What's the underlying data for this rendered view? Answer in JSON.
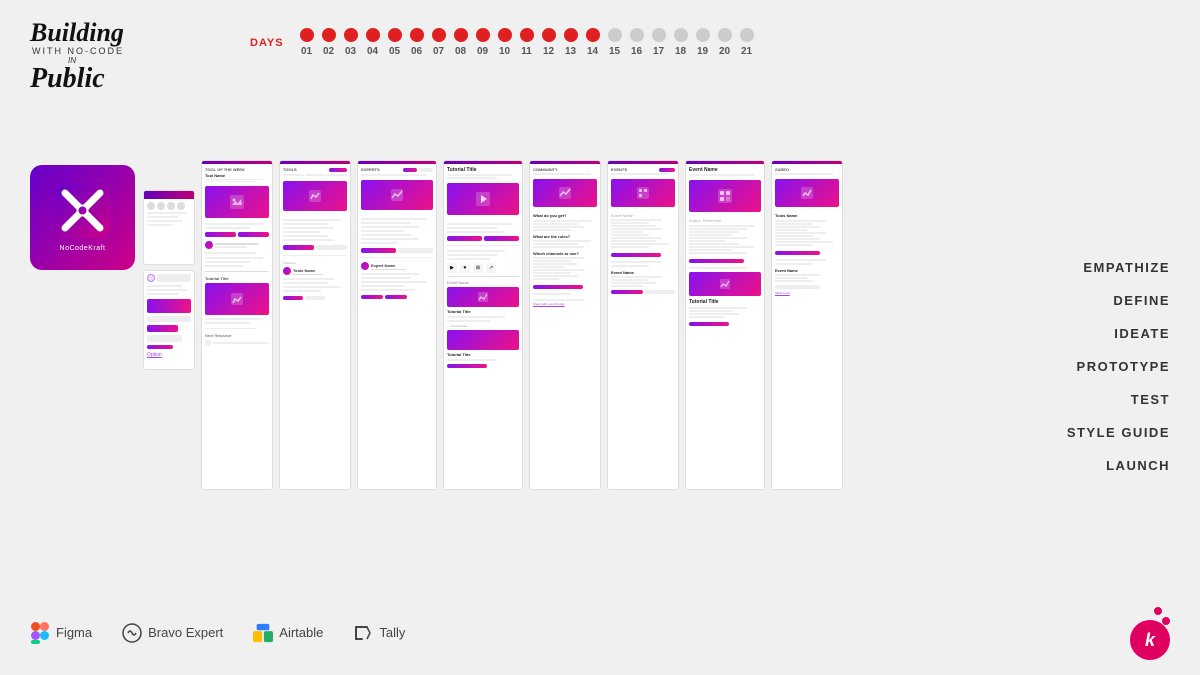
{
  "header": {
    "title_building": "Building",
    "title_with": "WITH NO-CODE",
    "title_in": "IN",
    "title_public": "Public",
    "days_label": "DAYS"
  },
  "days": [
    {
      "num": "01",
      "active": true
    },
    {
      "num": "02",
      "active": true
    },
    {
      "num": "03",
      "active": true
    },
    {
      "num": "04",
      "active": true
    },
    {
      "num": "05",
      "active": true
    },
    {
      "num": "06",
      "active": true
    },
    {
      "num": "07",
      "active": true
    },
    {
      "num": "08",
      "active": true
    },
    {
      "num": "09",
      "active": true
    },
    {
      "num": "10",
      "active": true
    },
    {
      "num": "11",
      "active": true
    },
    {
      "num": "12",
      "active": true
    },
    {
      "num": "13",
      "active": true
    },
    {
      "num": "14",
      "active": true
    },
    {
      "num": "15",
      "active": false
    },
    {
      "num": "16",
      "active": false
    },
    {
      "num": "17",
      "active": false
    },
    {
      "num": "18",
      "active": false
    },
    {
      "num": "19",
      "active": false
    },
    {
      "num": "20",
      "active": false
    },
    {
      "num": "21",
      "active": false
    }
  ],
  "phases": [
    "EMPATHIZE",
    "DEFINE",
    "IDEATE",
    "PROTOTYPE",
    "TEST",
    "STYLE GUIDE",
    "LAUNCH"
  ],
  "footer_tools": [
    {
      "name": "Figma",
      "icon": "figma"
    },
    {
      "name": "Bravo Expert",
      "icon": "bravo"
    },
    {
      "name": "Airtable",
      "icon": "airtable"
    },
    {
      "name": "Tally",
      "icon": "tally"
    }
  ],
  "nocodekraft": {
    "label": "NoCodeKraft"
  }
}
